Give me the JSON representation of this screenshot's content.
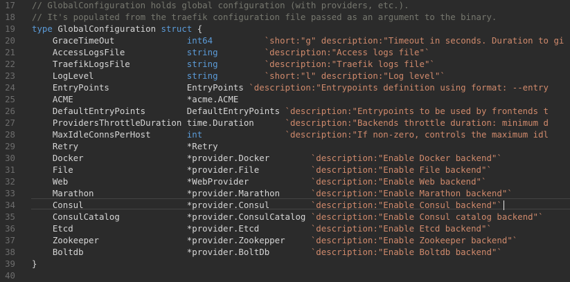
{
  "editor": {
    "lines": [
      {
        "num": "17",
        "parts": [
          {
            "t": "// GlobalConfiguration holds global configuration (with providers, etc.).",
            "c": "comment"
          }
        ]
      },
      {
        "num": "18",
        "parts": [
          {
            "t": "// It's populated from the traefik configuration file passed as an argument to the binary.",
            "c": "comment"
          }
        ]
      },
      {
        "num": "19",
        "parts": [
          {
            "t": "type ",
            "c": "kw"
          },
          {
            "t": "GlobalConfiguration ",
            "c": "plain"
          },
          {
            "t": "struct",
            "c": "kw"
          },
          {
            "t": " {",
            "c": "plain"
          }
        ]
      },
      {
        "num": "20",
        "parts": [
          {
            "t": "    GraceTimeOut              ",
            "c": "plain"
          },
          {
            "t": "int64",
            "c": "kw"
          },
          {
            "t": "          ",
            "c": "plain"
          },
          {
            "t": "`short:\"g\" description:\"Timeout in seconds. Duration to gi",
            "c": "str"
          }
        ]
      },
      {
        "num": "21",
        "parts": [
          {
            "t": "    AccessLogsFile            ",
            "c": "plain"
          },
          {
            "t": "string",
            "c": "kw"
          },
          {
            "t": "         ",
            "c": "plain"
          },
          {
            "t": "`description:\"Access logs file\"`",
            "c": "str"
          }
        ]
      },
      {
        "num": "22",
        "parts": [
          {
            "t": "    TraefikLogsFile           ",
            "c": "plain"
          },
          {
            "t": "string",
            "c": "kw"
          },
          {
            "t": "         ",
            "c": "plain"
          },
          {
            "t": "`description:\"Traefik logs file\"`",
            "c": "str"
          }
        ]
      },
      {
        "num": "23",
        "parts": [
          {
            "t": "    LogLevel                  ",
            "c": "plain"
          },
          {
            "t": "string",
            "c": "kw"
          },
          {
            "t": "         ",
            "c": "plain"
          },
          {
            "t": "`short:\"l\" description:\"Log level\"`",
            "c": "str"
          }
        ]
      },
      {
        "num": "24",
        "parts": [
          {
            "t": "    EntryPoints               EntryPoints ",
            "c": "plain"
          },
          {
            "t": "`description:\"Entrypoints definition using format: --entry",
            "c": "str"
          }
        ]
      },
      {
        "num": "25",
        "parts": [
          {
            "t": "    ACME                      *acme.ACME",
            "c": "plain"
          }
        ]
      },
      {
        "num": "26",
        "parts": [
          {
            "t": "    DefaultEntryPoints        DefaultEntryPoints ",
            "c": "plain"
          },
          {
            "t": "`description:\"Entrypoints to be used by frontends t",
            "c": "str"
          }
        ]
      },
      {
        "num": "27",
        "parts": [
          {
            "t": "    ProvidersThrottleDuration time.Duration      ",
            "c": "plain"
          },
          {
            "t": "`description:\"Backends throttle duration: minimum d",
            "c": "str"
          }
        ]
      },
      {
        "num": "28",
        "parts": [
          {
            "t": "    MaxIdleConnsPerHost       ",
            "c": "plain"
          },
          {
            "t": "int",
            "c": "kw"
          },
          {
            "t": "                ",
            "c": "plain"
          },
          {
            "t": "`description:\"If non-zero, controls the maximum idl",
            "c": "str"
          }
        ]
      },
      {
        "num": "29",
        "parts": [
          {
            "t": "    Retry                     *Retry",
            "c": "plain"
          }
        ]
      },
      {
        "num": "30",
        "parts": [
          {
            "t": "    Docker                    *provider.Docker        ",
            "c": "plain"
          },
          {
            "t": "`description:\"Enable Docker backend\"`",
            "c": "str"
          }
        ]
      },
      {
        "num": "31",
        "parts": [
          {
            "t": "    File                      *provider.File          ",
            "c": "plain"
          },
          {
            "t": "`description:\"Enable File backend\"`",
            "c": "str"
          }
        ]
      },
      {
        "num": "32",
        "parts": [
          {
            "t": "    Web                       *WebProvider            ",
            "c": "plain"
          },
          {
            "t": "`description:\"Enable Web backend\"`",
            "c": "str"
          }
        ]
      },
      {
        "num": "33",
        "parts": [
          {
            "t": "    Marathon                  *provider.Marathon      ",
            "c": "plain"
          },
          {
            "t": "`description:\"Enable Marathon backend\"`",
            "c": "str"
          }
        ]
      },
      {
        "num": "34",
        "parts": [
          {
            "t": "    Consul                    *provider.Consul        ",
            "c": "plain"
          },
          {
            "t": "`description:\"Enable Consul backend\"`",
            "c": "str"
          }
        ]
      },
      {
        "num": "35",
        "parts": [
          {
            "t": "    ConsulCatalog             *provider.ConsulCatalog ",
            "c": "plain"
          },
          {
            "t": "`description:\"Enable Consul catalog backend\"`",
            "c": "str"
          }
        ]
      },
      {
        "num": "36",
        "parts": [
          {
            "t": "    Etcd                      *provider.Etcd          ",
            "c": "plain"
          },
          {
            "t": "`description:\"Enable Etcd backend\"`",
            "c": "str"
          }
        ]
      },
      {
        "num": "37",
        "parts": [
          {
            "t": "    Zookeeper                 *provider.Zookepper     ",
            "c": "plain"
          },
          {
            "t": "`description:\"Enable Zookeeper backend\"`",
            "c": "str"
          }
        ]
      },
      {
        "num": "38",
        "parts": [
          {
            "t": "    Boltdb                    *provider.BoltDb        ",
            "c": "plain"
          },
          {
            "t": "`description:\"Enable Boltdb backend\"`",
            "c": "str"
          }
        ]
      },
      {
        "num": "39",
        "parts": [
          {
            "t": "}",
            "c": "plain"
          }
        ]
      },
      {
        "num": "40",
        "parts": []
      }
    ],
    "current_line": "34",
    "colors": {
      "background": "#2b2b2b",
      "comment": "#77786f",
      "keyword": "#5b9bd8",
      "string": "#d08a6c",
      "text": "#d6d6d6",
      "gutter": "#6d6d6d"
    }
  }
}
